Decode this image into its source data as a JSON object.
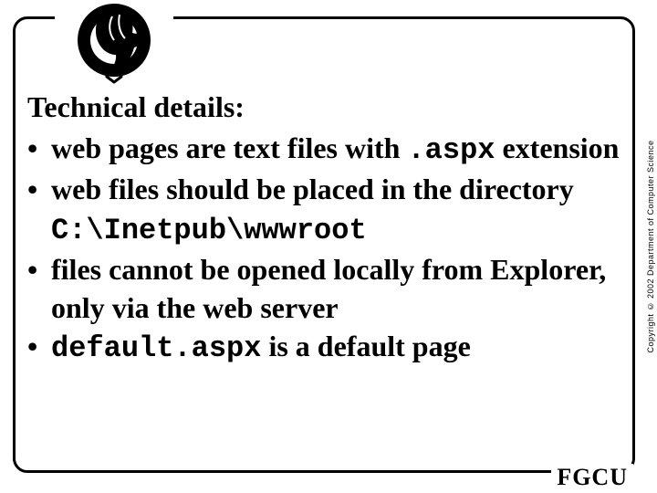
{
  "slide": {
    "title": "Technical details:",
    "bullets": [
      {
        "parts": [
          {
            "text": "web pages are text files with ",
            "mono": false
          },
          {
            "text": ".aspx",
            "mono": true
          },
          {
            "text": " extension",
            "mono": false
          }
        ]
      },
      {
        "parts": [
          {
            "text": "web files should be placed in the directory ",
            "mono": false
          },
          {
            "text": "C:\\Inetpub\\wwwroot",
            "mono": true
          }
        ]
      },
      {
        "parts": [
          {
            "text": "files cannot be opened locally from Explorer, only via the web server",
            "mono": false
          }
        ]
      },
      {
        "parts": [
          {
            "text": "default.aspx",
            "mono": true
          },
          {
            "text": " is a default page",
            "mono": false
          }
        ]
      }
    ]
  },
  "footer": {
    "org": "FGCU"
  },
  "side_note": "Copyright © 2002 Department of Computer Science",
  "icons": {
    "logo": "eagle-o-logo"
  }
}
